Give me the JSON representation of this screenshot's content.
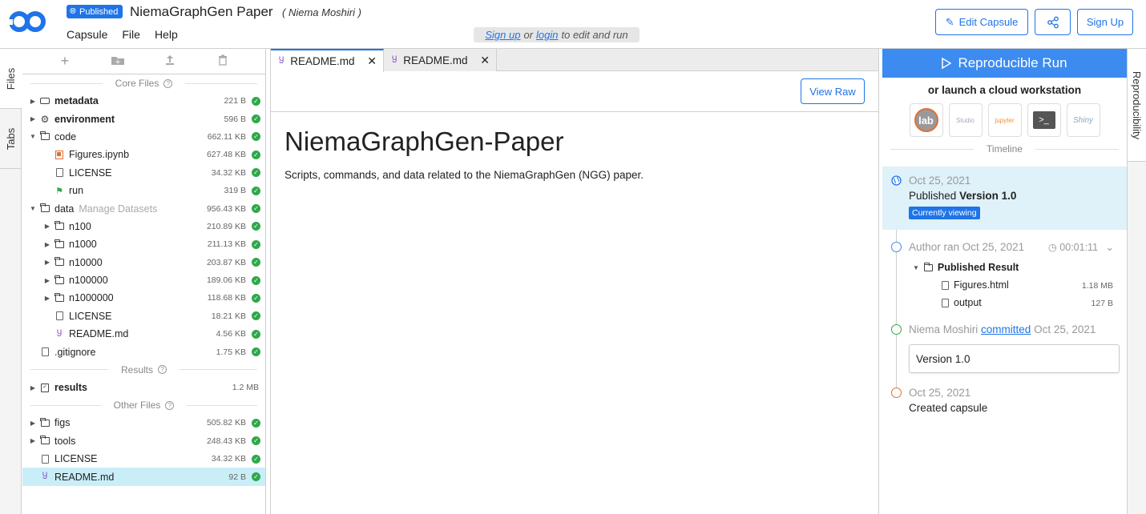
{
  "header": {
    "published_badge": "Published",
    "title": "NiemaGraphGen Paper",
    "author": "( Niema Moshiri )",
    "menu": [
      "Capsule",
      "File",
      "Help"
    ],
    "signup_note": {
      "signup": "Sign up",
      "or": "or",
      "login": "login",
      "rest": "to edit and run"
    },
    "edit_capsule": "Edit Capsule",
    "sign_up": "Sign Up"
  },
  "left_rail": {
    "files_tab": "Files",
    "tabs_tab": "Tabs"
  },
  "file_panel": {
    "sections": {
      "core": "Core Files",
      "results": "Results",
      "other": "Other Files"
    },
    "core_files": [
      {
        "name": "metadata",
        "size": "221 B",
        "bold": true,
        "arrow": "▶",
        "icon": "metadata-icon",
        "indent": 0
      },
      {
        "name": "environment",
        "size": "596 B",
        "bold": true,
        "arrow": "▶",
        "icon": "gear-icon",
        "indent": 0
      },
      {
        "name": "code",
        "size": "662.11 KB",
        "bold": false,
        "arrow": "▼",
        "icon": "folder-icon",
        "indent": 0
      },
      {
        "name": "Figures.ipynb",
        "size": "627.48 KB",
        "bold": false,
        "arrow": "",
        "icon": "notebook-icon",
        "indent": 1
      },
      {
        "name": "LICENSE",
        "size": "34.32 KB",
        "bold": false,
        "arrow": "",
        "icon": "file-icon",
        "indent": 1
      },
      {
        "name": "run",
        "size": "319 B",
        "bold": false,
        "arrow": "",
        "icon": "flag-icon",
        "indent": 1
      },
      {
        "name": "data",
        "meta": "Manage Datasets",
        "size": "956.43 KB",
        "bold": false,
        "arrow": "▼",
        "icon": "folder-icon",
        "indent": 0
      },
      {
        "name": "n100",
        "size": "210.89 KB",
        "bold": false,
        "arrow": "▶",
        "icon": "folder-icon",
        "indent": 1
      },
      {
        "name": "n1000",
        "size": "211.13 KB",
        "bold": false,
        "arrow": "▶",
        "icon": "folder-icon",
        "indent": 1
      },
      {
        "name": "n10000",
        "size": "203.87 KB",
        "bold": false,
        "arrow": "▶",
        "icon": "folder-icon",
        "indent": 1
      },
      {
        "name": "n100000",
        "size": "189.06 KB",
        "bold": false,
        "arrow": "▶",
        "icon": "folder-icon",
        "indent": 1
      },
      {
        "name": "n1000000",
        "size": "118.68 KB",
        "bold": false,
        "arrow": "▶",
        "icon": "folder-icon",
        "indent": 1
      },
      {
        "name": "LICENSE",
        "size": "18.21 KB",
        "bold": false,
        "arrow": "",
        "icon": "file-icon",
        "indent": 1
      },
      {
        "name": "README.md",
        "size": "4.56 KB",
        "bold": false,
        "arrow": "",
        "icon": "markdown-icon",
        "indent": 1
      },
      {
        "name": ".gitignore",
        "size": "1.75 KB",
        "bold": false,
        "arrow": "",
        "icon": "file-icon",
        "indent": 0
      }
    ],
    "results_files": [
      {
        "name": "results",
        "size": "1.2 MB",
        "bold": true,
        "arrow": "▶",
        "icon": "results-icon",
        "indent": 0,
        "nocheck": true
      }
    ],
    "other_files": [
      {
        "name": "figs",
        "size": "505.82 KB",
        "bold": false,
        "arrow": "▶",
        "icon": "folder-icon",
        "indent": 0
      },
      {
        "name": "tools",
        "size": "248.43 KB",
        "bold": false,
        "arrow": "▶",
        "icon": "folder-icon",
        "indent": 0
      },
      {
        "name": "LICENSE",
        "size": "34.32 KB",
        "bold": false,
        "arrow": "",
        "icon": "file-icon",
        "indent": 0
      },
      {
        "name": "README.md",
        "size": "92 B",
        "bold": false,
        "arrow": "",
        "icon": "markdown-icon",
        "indent": 0,
        "selected": true
      }
    ]
  },
  "editor": {
    "tabs": [
      {
        "label": "README.md",
        "active": true
      },
      {
        "label": "README.md",
        "active": false
      }
    ],
    "view_raw": "View Raw",
    "doc_title": "NiemaGraphGen-Paper",
    "doc_body": "Scripts, commands, and data related to the NiemaGraphGen (NGG) paper."
  },
  "right_panel": {
    "run_button": "Reproducible Run",
    "launch_label": "or launch a cloud workstation",
    "workstations": [
      "lab",
      "Studio",
      "jupyter",
      ">_",
      "Shiny"
    ],
    "timeline_label": "Timeline",
    "timeline": {
      "published_date": "Oct 25, 2021",
      "published_text": "Published",
      "published_version": "Version 1.0",
      "currently_viewing": "Currently viewing",
      "run_text": "Author ran Oct 25, 2021",
      "run_duration": "00:01:11",
      "result_folder": "Published Result",
      "result_files": [
        {
          "name": "Figures.html",
          "size": "1.18 MB"
        },
        {
          "name": "output",
          "size": "127 B"
        }
      ],
      "commit_author": "Niema Moshiri",
      "commit_link": "committed",
      "commit_date": "Oct 25, 2021",
      "commit_message": "Version 1.0",
      "created_date": "Oct 25, 2021",
      "created_text": "Created capsule"
    },
    "colors": {
      "accent": "#1f74e8",
      "run_bg": "#3c8bf0",
      "ok": "#2ea84a",
      "commit": "#2ea84a",
      "created": "#e07030"
    }
  },
  "right_rail": {
    "reproducibility_tab": "Reproducibility"
  }
}
